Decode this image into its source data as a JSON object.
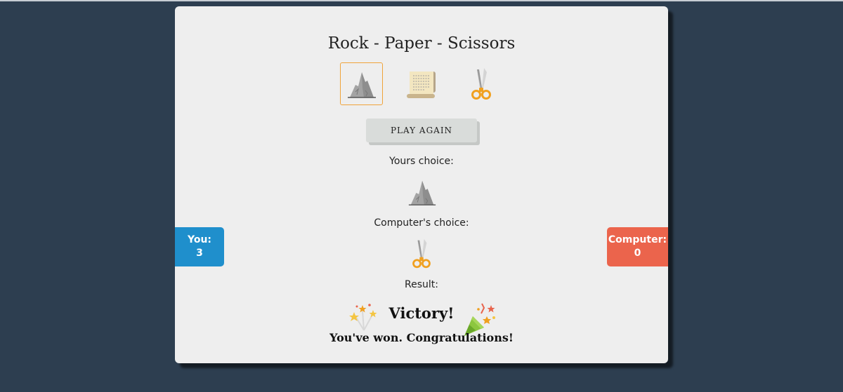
{
  "title": "Rock - Paper - Scissors",
  "choices": [
    {
      "name": "rock",
      "icon": "rock-icon",
      "selected": true
    },
    {
      "name": "paper",
      "icon": "paper-scroll-icon",
      "selected": false
    },
    {
      "name": "scissors",
      "icon": "scissors-icon",
      "selected": false
    }
  ],
  "play_again_label": "PLAY AGAIN",
  "yours_choice_label": "Yours choice:",
  "yours_choice_icon": "rock-icon",
  "computer_choice_label": "Computer's choice:",
  "computer_choice_icon": "scissors-icon",
  "result_label": "Result:",
  "result_title": "Victory!",
  "result_message": "You've won. Congratulations!",
  "result_icons": [
    "fireworks-icon",
    "party-popper-icon"
  ],
  "score": {
    "you_label": "You:",
    "you_value": "3",
    "computer_label": "Computer:",
    "computer_value": "0"
  },
  "colors": {
    "background": "#2d3e50",
    "card": "#eeeeee",
    "selected_border": "#f0a33a",
    "you_badge": "#1f8fcc",
    "computer_badge": "#eb644c"
  }
}
